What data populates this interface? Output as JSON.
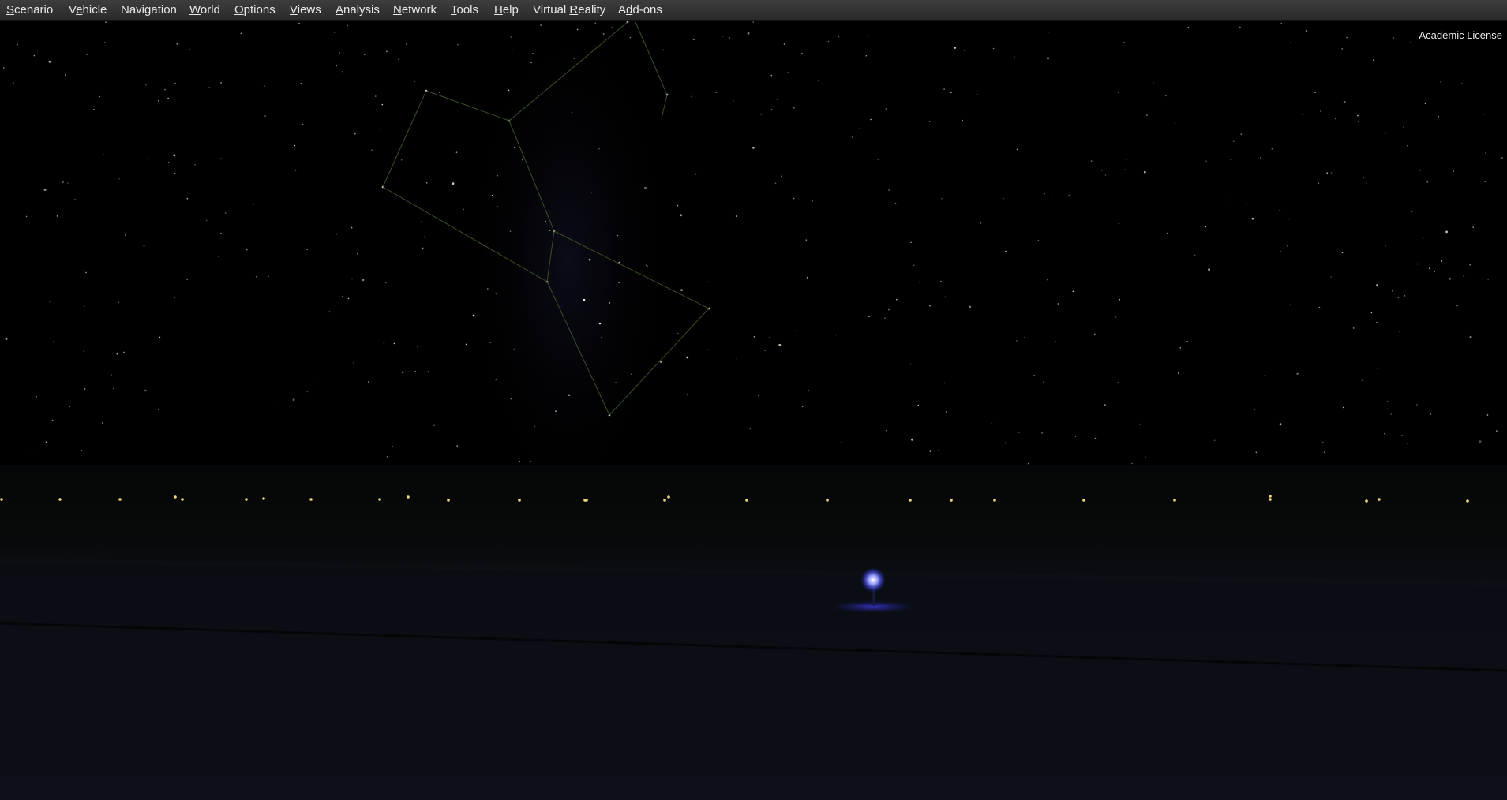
{
  "menubar": {
    "items": [
      {
        "key": "scenario",
        "label": "Scenario",
        "mnemonic": "S"
      },
      {
        "key": "vehicle",
        "label": "Vehicle",
        "mnemonic": "e"
      },
      {
        "key": "navigation",
        "label": "Navigation",
        "mnemonic": ""
      },
      {
        "key": "world",
        "label": "World",
        "mnemonic": "W"
      },
      {
        "key": "options",
        "label": "Options",
        "mnemonic": "O"
      },
      {
        "key": "views",
        "label": "Views",
        "mnemonic": "V"
      },
      {
        "key": "analysis",
        "label": "Analysis",
        "mnemonic": "A"
      },
      {
        "key": "network",
        "label": "Network",
        "mnemonic": "N"
      },
      {
        "key": "tools",
        "label": "Tools",
        "mnemonic": "T"
      },
      {
        "key": "help",
        "label": "Help",
        "mnemonic": "H"
      },
      {
        "key": "virtual-reality",
        "label": "Virtual Reality",
        "mnemonic": "R"
      },
      {
        "key": "add-ons",
        "label": "Add-ons",
        "mnemonic": "d"
      }
    ]
  },
  "overlay": {
    "license_text": "Academic License"
  },
  "colors": {
    "sky": "#000000",
    "ground_horizon": "#06090a",
    "ground_near": "#0c0d16",
    "constellation_line": "#3f5a2c",
    "star": "#d8d8c8",
    "runway_light": "#f2d77a",
    "beacon": "#7d86ff",
    "menubar": "#333333"
  },
  "icons": {
    "beacon": "landing-light-icon"
  }
}
